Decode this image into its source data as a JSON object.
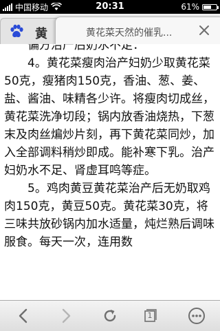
{
  "status_bar": {
    "carrier": "中国移动",
    "time": "20:31",
    "battery_percent_label": "61%",
    "battery_level": 0.61
  },
  "tabs": {
    "back_tab_title": "黄",
    "active_tab_title": "黄花菜天然的催乳..."
  },
  "article": {
    "lines": [
      "偏方治产后奶水不足：",
      "4。黄花菜瘦肉治产妇奶少取黄花菜50克，瘦猪肉150克，香油、葱、姜、盐、酱油、味精各少许。将瘦肉切成丝，黄花菜洗净切段；锅内放香油烧热，下葱末及肉丝煸炒片刻，再下黄花菜同炒，加入全部调料稍炒即成。能补寒下乳。治产妇奶水不足、肾虚耳鸣等症。",
      "5。鸡肉黄豆黄花菜治产后无奶取鸡肉150克，黄豆50克。黄花菜30克，将三味共放砂锅内加水适量，炖烂熟后调味服食。每天一次，连用数"
    ]
  },
  "toolbar": {
    "tab_count": "1"
  },
  "colors": {
    "status_bar_bg": "#000000",
    "text": "#111111",
    "icon_gray": "#6e6e6e",
    "icon_disabled": "#b5b5b5",
    "paw_blue": "#2a4bd7"
  }
}
